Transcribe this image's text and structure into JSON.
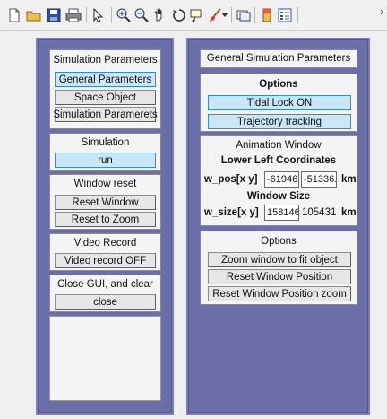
{
  "toolbar": {
    "icons": [
      "new-figure-icon",
      "open-file-icon",
      "save-icon",
      "print-icon",
      "pointer-icon",
      "zoom-in-icon",
      "zoom-out-icon",
      "pan-icon",
      "rotate-3d-icon",
      "data-cursor-icon",
      "brush-icon",
      "insert-colorbar-icon",
      "link-plot-icon",
      "insert-legend-icon",
      "more-tools-icon"
    ]
  },
  "left": {
    "sim_params": {
      "title": "Simulation Parameters",
      "general_btn": "General Parameters",
      "space_btn": "Space Object",
      "paramerets_btn": "Simulation Paramerets"
    },
    "simulation": {
      "title": "Simulation",
      "run_btn": "run"
    },
    "window_reset": {
      "title": "Window reset",
      "reset_window_btn": "Reset Window",
      "reset_zoom_btn": "Reset to Zoom"
    },
    "video": {
      "title": "Video Record",
      "video_btn": "Video record OFF"
    },
    "close": {
      "title": "Close GUI, and clear",
      "close_btn": "close"
    }
  },
  "right": {
    "header": "General Simulation Parameters",
    "options": {
      "title": "Options",
      "tidal_btn": "Tidal Lock ON",
      "trajectory_btn": "Trajectory tracking"
    },
    "animation": {
      "title": "Animation Window",
      "lower_left": "Lower Left Coordinates",
      "wpos_label": "w_pos[x y]",
      "wpos_x": "-61946",
      "wpos_y": "-51336.",
      "wpos_unit": "km",
      "window_size": "Window Size",
      "wsize_label": "w_size[x y]",
      "wsize_x": "158146",
      "wsize_y": "105431",
      "wsize_unit": "km"
    },
    "options2": {
      "title": "Options",
      "zoom_btn": "Zoom window to fit object",
      "reset_pos_btn": "Reset Window Position",
      "reset_pos_zoom_btn": "Reset Window Position zoom"
    }
  }
}
